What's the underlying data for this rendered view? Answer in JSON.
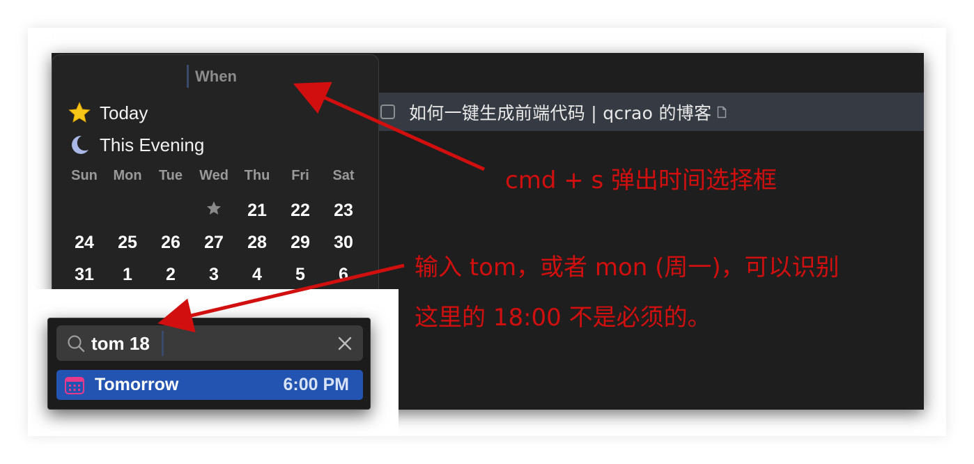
{
  "app": {
    "todo": {
      "title": "如何一键生成前端代码 | qcrao 的博客"
    }
  },
  "when_popup": {
    "label": "When",
    "quick_options": [
      {
        "label": "Today",
        "icon": "star-icon"
      },
      {
        "label": "This Evening",
        "icon": "moon-icon"
      }
    ],
    "weekdays": [
      "Sun",
      "Mon",
      "Tue",
      "Wed",
      "Thu",
      "Fri",
      "Sat"
    ],
    "weeks": [
      [
        "",
        "",
        "",
        "★",
        "21",
        "22",
        "23"
      ],
      [
        "24",
        "25",
        "26",
        "27",
        "28",
        "29",
        "30"
      ],
      [
        "31",
        "1",
        "2",
        "3",
        "4",
        "5",
        "6"
      ]
    ]
  },
  "search_popup": {
    "query": "tom 18",
    "result": {
      "label": "Tomorrow",
      "time": "6:00 PM"
    }
  },
  "annotations": {
    "line1": "cmd + s 弹出时间选择框",
    "line2": "输入 tom，或者 mon (周一)，可以识别",
    "line3": "这里的 18:00 不是必须的。"
  },
  "colors": {
    "annotation_red": "#d10f0f",
    "selection_blue": "#2354b2",
    "star_yellow": "#f5c518",
    "moon_blue": "#a9b8e6",
    "calendar_pink": "#e8398a"
  }
}
